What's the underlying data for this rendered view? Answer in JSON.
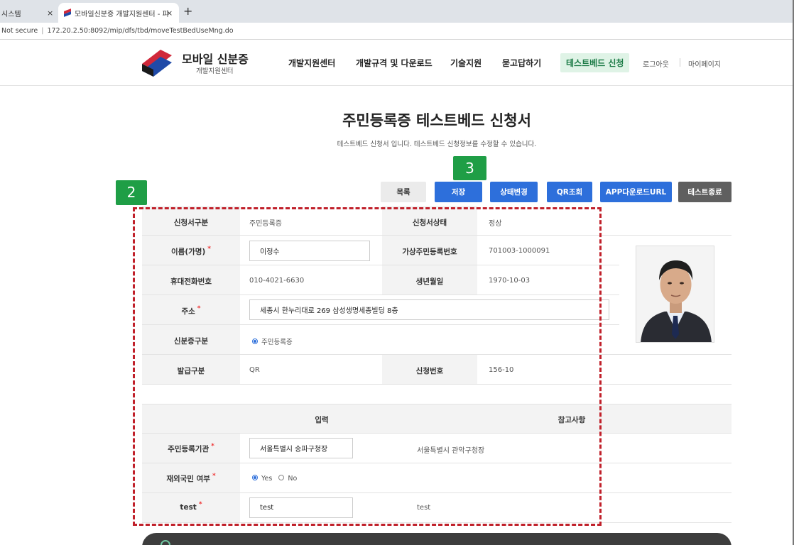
{
  "browser": {
    "tabs": [
      {
        "label": "시스템",
        "close": "×"
      },
      {
        "label": "모바일신분증 개발지원센터 - 피",
        "close": "×"
      }
    ],
    "new_tab": "+",
    "security": "Not secure",
    "url": "172.20.2.50:8092/mip/dfs/tbd/moveTestBedUseMng.do"
  },
  "site": {
    "logo_title": "모바일 신분증",
    "logo_sub": "개발지원센터",
    "nav": [
      "개발지원센터",
      "개발규격 및 다운로드",
      "기술지원",
      "묻고답하기",
      "테스트베드 신청"
    ],
    "logout": "로그아웃",
    "mypage": "마이페이지"
  },
  "page": {
    "title": "주민등록증 테스트베드 신청서",
    "description": "테스트베드 신청서 입니다. 테스트베드 신청정보를 수정할 수 있습니다."
  },
  "markers": {
    "box": "2",
    "save": "3"
  },
  "actions": {
    "list": "목록",
    "save": "저장",
    "status_change": "상태변경",
    "qr": "QR조회",
    "app_url": "APP다운로드URL",
    "test_end": "테스트종료"
  },
  "form": {
    "app_type_label": "신청서구분",
    "app_type_value": "주민등록증",
    "app_status_label": "신청서상태",
    "app_status_value": "정상",
    "name_label": "이름(가명)",
    "name_value": "이정수",
    "virtual_id_label": "가상주민등록번호",
    "virtual_id_value": "701003-1000091",
    "phone_label": "휴대전화번호",
    "phone_value": "010-4021-6630",
    "birth_label": "생년월일",
    "birth_value": "1970-10-03",
    "address_label": "주소",
    "address_value": "세종시 한누리대로 269 삼성생명세종빌딩 8층",
    "id_type_label": "신분증구분",
    "id_type_value": "주민등록증",
    "issue_type_label": "발급구분",
    "issue_type_value": "QR",
    "app_no_label": "신청번호",
    "app_no_value": "156-10",
    "required_mark": "*"
  },
  "extra": {
    "col_input": "입력",
    "col_reference": "참고사항",
    "agency_label": "주민등록기관",
    "agency_value": "서울특별시 송파구청장",
    "agency_reference": "서울특별시 관악구청장",
    "overseas_label": "재외국민 여부",
    "overseas_yes": "Yes",
    "overseas_no": "No",
    "test_label": "test",
    "test_value": "test",
    "test_reference": "test"
  },
  "colors": {
    "accent_blue": "#2d6fdb",
    "marker_green": "#1f9e46",
    "highlight_red": "#c0202a",
    "nav_active_bg": "#dff3e6"
  }
}
